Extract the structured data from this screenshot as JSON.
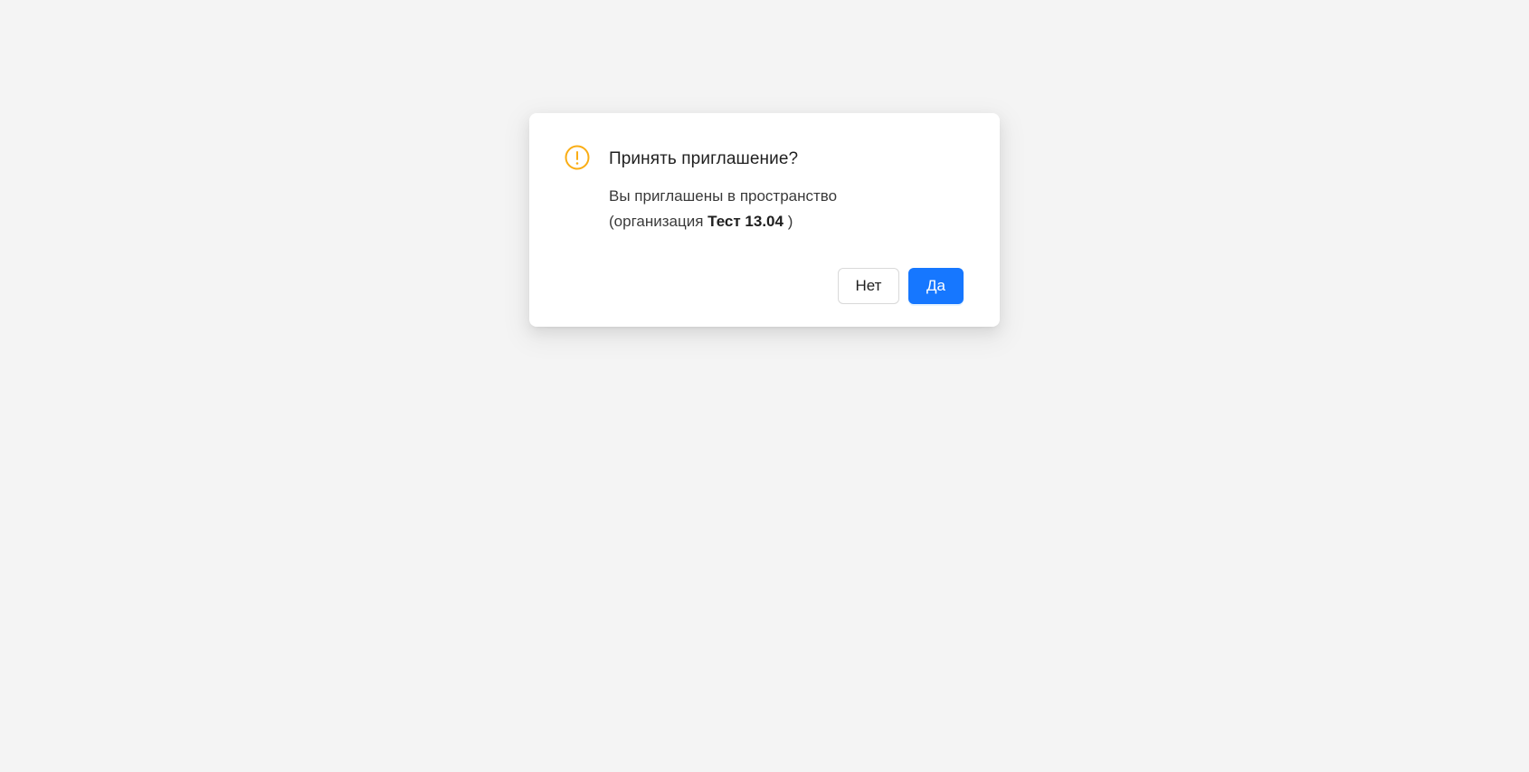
{
  "dialog": {
    "title": "Принять приглашение?",
    "message_line1": "Вы приглашены в пространство",
    "message_prefix": "(организация ",
    "org_name": "Тест 13.04",
    "message_suffix": " )",
    "icon": "exclamation-circle-icon",
    "icon_color": "#faad14"
  },
  "buttons": {
    "no_label": "Нет",
    "yes_label": "Да",
    "primary_color": "#1677ff"
  }
}
